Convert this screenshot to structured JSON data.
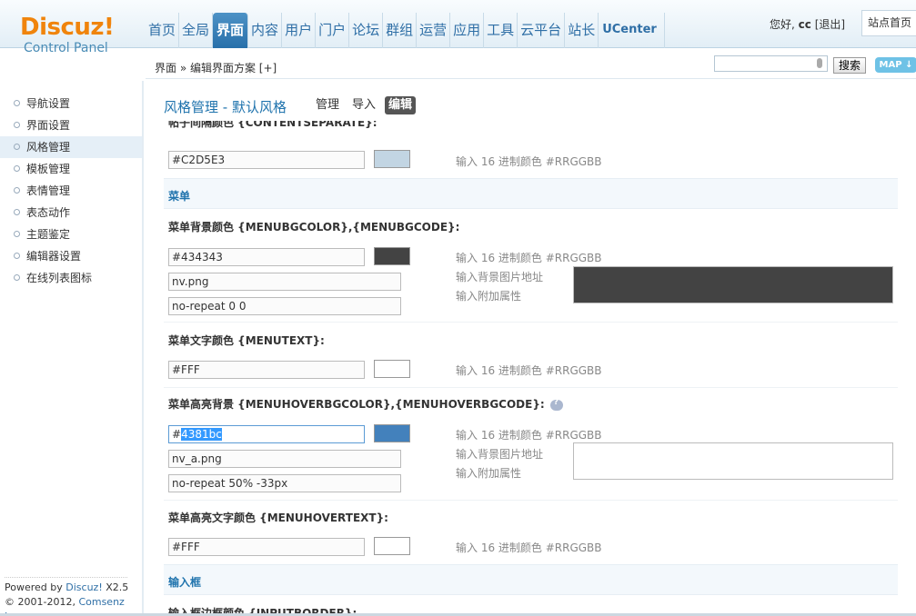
{
  "logo": {
    "main": "Discuz!",
    "sub": "Control Panel"
  },
  "topnav": [
    "首页",
    "全局",
    "界面",
    "内容",
    "用户",
    "门户",
    "论坛",
    "群组",
    "运营",
    "应用",
    "工具",
    "云平台",
    "站长",
    "UCenter"
  ],
  "topnav_active": "界面",
  "user": {
    "greet_prefix": "您好,",
    "name": "cc",
    "logout": "[退出]",
    "home": "站点首页"
  },
  "breadcrumb": "界面 » 编辑界面方案 [+]",
  "search": {
    "button": "搜索",
    "map": "MAP"
  },
  "sidebar": {
    "items": [
      "导航设置",
      "界面设置",
      "风格管理",
      "模板管理",
      "表情管理",
      "表态动作",
      "主题鉴定",
      "编辑器设置",
      "在线列表图标"
    ],
    "active": "风格管理",
    "footer_powered": "Powered by ",
    "footer_brand": "Discuz!",
    "footer_version": " X2.5",
    "footer_copy": "© 2001-2012, ",
    "footer_company": "Comsenz Inc."
  },
  "main": {
    "title": "风格管理 - 默认风格",
    "tabs": [
      "管理",
      "导入",
      "编辑"
    ],
    "active_tab": "编辑",
    "partial_label": "帖子间隔颜色 {CONTENTSEPARATE}:",
    "contentsep": {
      "value": "#C2D5E3",
      "swatch": "#C2D5E3",
      "hint": "输入 16 进制颜色 #RRGGBB"
    },
    "section_menu": "菜单",
    "menubg": {
      "label": "菜单背景颜色 {MENUBGCOLOR},{MENUBGCODE}:",
      "color": "#434343",
      "swatch": "#434343",
      "image": "nv.png",
      "extra": "no-repeat 0 0",
      "hint_color": "输入 16 进制颜色 #RRGGBB",
      "hint_image": "输入背景图片地址",
      "hint_extra": "输入附加属性",
      "preview": "#434343"
    },
    "menutext": {
      "label": "菜单文字颜色 {MENUTEXT}:",
      "value": "#FFF",
      "swatch": "#FFFFFF",
      "hint": "输入 16 进制颜色 #RRGGBB"
    },
    "menuhover": {
      "label": "菜单高亮背景 {MENUHOVERBGCOLOR},{MENUHOVERBGCODE}:",
      "color_prefix": "#",
      "color_selected": "4381bc",
      "swatch": "#4381BC",
      "image": "nv_a.png",
      "extra": "no-repeat 50% -33px",
      "hint_color": "输入 16 进制颜色 #RRGGBB",
      "hint_image": "输入背景图片地址",
      "hint_extra": "输入附加属性",
      "preview": "#FFFFFF"
    },
    "menuhovertext": {
      "label": "菜单高亮文字颜色 {MENUHOVERTEXT}:",
      "value": "#FFF",
      "swatch": "#FFFFFF",
      "hint": "输入 16 进制颜色 #RRGGBB"
    },
    "section_input": "输入框",
    "partial_bottom": "输入框边框颜色 {INPUTBORDER}:"
  }
}
